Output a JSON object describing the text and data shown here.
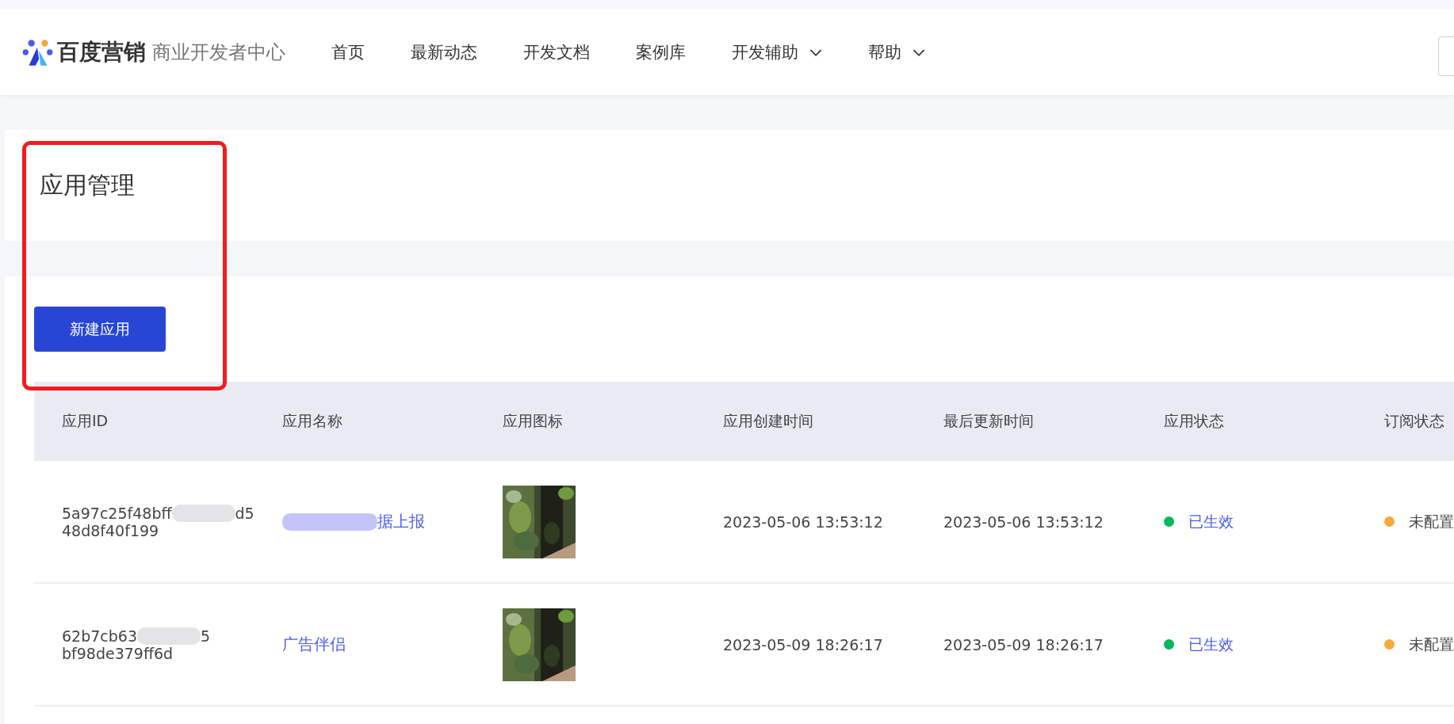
{
  "header": {
    "brand": "百度营销",
    "subtitle": "商业开发者中心",
    "nav": [
      {
        "label": "首页",
        "dropdown": false
      },
      {
        "label": "最新动态",
        "dropdown": false
      },
      {
        "label": "开发文档",
        "dropdown": false
      },
      {
        "label": "案例库",
        "dropdown": false
      },
      {
        "label": "开发辅助",
        "dropdown": true
      },
      {
        "label": "帮助",
        "dropdown": true
      }
    ]
  },
  "page": {
    "title": "应用管理",
    "new_button": "新建应用"
  },
  "table": {
    "columns": [
      "应用ID",
      "应用名称",
      "应用图标",
      "应用创建时间",
      "最后更新时间",
      "应用状态",
      "订阅状态"
    ],
    "rows": [
      {
        "id_head": "5a97c25f48bff",
        "id_tail": "d5",
        "id_line2": "48d8f40f199",
        "name_head": "",
        "name_tail": "据上报",
        "created": "2023-05-06 13:53:12",
        "updated": "2023-05-06 13:53:12",
        "status": {
          "label": "已生效",
          "color": "#00b85c"
        },
        "subscription": {
          "label": "未配置",
          "color": "#f7a838"
        }
      },
      {
        "id_head": "62b7cb63",
        "id_tail": "5",
        "id_line2": "bf98de379ff6d",
        "name_head": "广告伴侣",
        "name_tail": "",
        "created": "2023-05-09 18:26:17",
        "updated": "2023-05-09 18:26:17",
        "status": {
          "label": "已生效",
          "color": "#00b85c"
        },
        "subscription": {
          "label": "未配置",
          "color": "#f7a838"
        }
      }
    ]
  }
}
